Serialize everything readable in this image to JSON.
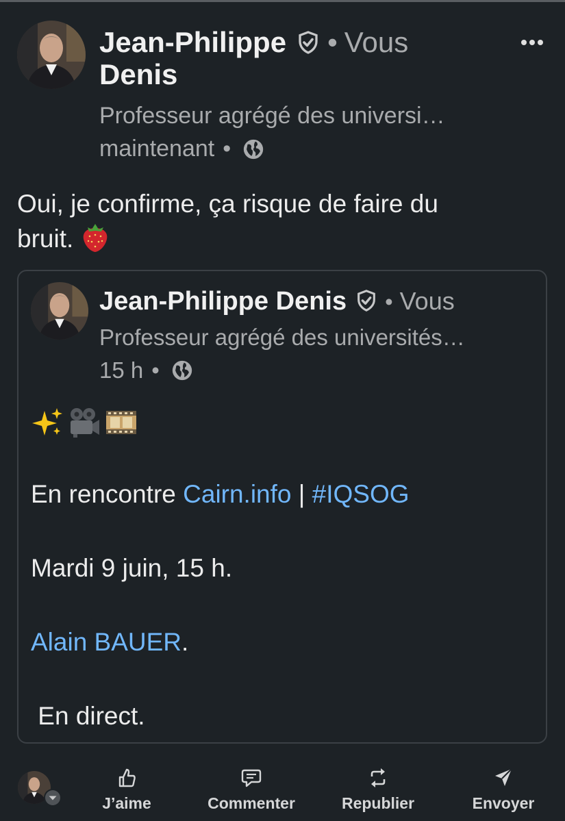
{
  "post": {
    "author_line1": "Jean-Philippe",
    "author_line2": "Denis",
    "relation": "Vous",
    "headline": "Professeur agrégé des universi…",
    "time": "maintenant",
    "text_line1": "Oui, je confirme, ça risque de faire du",
    "text_line2": "bruit."
  },
  "shared": {
    "author": "Jean-Philippe Denis",
    "relation": "Vous",
    "headline": "Professeur agrégé des universités…",
    "time": "15 h",
    "line1_prefix": "En rencontre ",
    "line1_link": "Cairn.info",
    "line1_sep": " | ",
    "line1_hashtag": "#IQSOG",
    "line2": "Mardi 9 juin, 15 h.",
    "line3_link": "Alain BAUER",
    "line3_suffix": ".",
    "line4": " En direct."
  },
  "actions": {
    "like": "J’aime",
    "comment": "Commenter",
    "repost": "Republier",
    "send": "Envoyer"
  },
  "icons": {
    "verified": "shield-check-icon",
    "visibility": "globe-icon",
    "more": "ellipsis-icon",
    "emojis": [
      "sparkles-icon",
      "movie-camera-icon",
      "film-strip-icon"
    ]
  },
  "colors": {
    "background": "#1d2226",
    "link": "#71b7fb",
    "secondary_text": "#a9abad",
    "card_border": "#3b4045"
  }
}
